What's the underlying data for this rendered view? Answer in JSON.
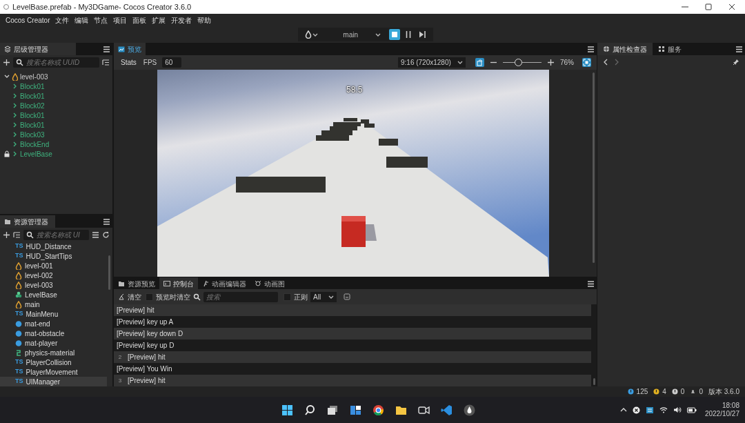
{
  "window": {
    "title": "LevelBase.prefab - My3DGame- Cocos Creator 3.6.0"
  },
  "menu": [
    "Cocos Creator",
    "文件",
    "编辑",
    "节点",
    "项目",
    "面板",
    "扩展",
    "开发者",
    "帮助"
  ],
  "toolbar": {
    "scene_select": "main",
    "play_controls": [
      {
        "kind": "stop",
        "active": true
      },
      {
        "kind": "pause",
        "active": false
      },
      {
        "kind": "step",
        "active": false
      }
    ]
  },
  "hierarchy": {
    "title": "层级管理器",
    "search": {
      "placeholder": "搜索名称或 UUID"
    },
    "tree": [
      {
        "label": "level-003",
        "kind": "scene",
        "expanded": true,
        "locked": false,
        "children": [
          {
            "label": "Block01",
            "kind": "prefab",
            "expanded": false,
            "locked": false
          },
          {
            "label": "Block01",
            "kind": "prefab",
            "expanded": false,
            "locked": false
          },
          {
            "label": "Block02",
            "kind": "prefab",
            "expanded": false,
            "locked": false
          },
          {
            "label": "Block01",
            "kind": "prefab",
            "expanded": false,
            "locked": false
          },
          {
            "label": "Block01",
            "kind": "prefab",
            "expanded": false,
            "locked": false
          },
          {
            "label": "Block03",
            "kind": "prefab",
            "expanded": false,
            "locked": false
          },
          {
            "label": "BlockEnd",
            "kind": "prefab",
            "expanded": false,
            "locked": false
          }
        ]
      },
      {
        "label": "LevelBase",
        "kind": "prefab",
        "expanded": false,
        "locked": true
      }
    ]
  },
  "assets": {
    "title": "资源管理器",
    "search": {
      "placeholder": "搜索名称或 UI"
    },
    "items": [
      {
        "label": "HUD_Distance",
        "kind": "script",
        "tag": "TS",
        "selected": false
      },
      {
        "label": "HUD_StartTips",
        "kind": "script",
        "tag": "TS",
        "selected": false
      },
      {
        "label": "level-001",
        "kind": "scene",
        "selected": false
      },
      {
        "label": "level-002",
        "kind": "scene",
        "selected": false
      },
      {
        "label": "level-003",
        "kind": "scene",
        "selected": false
      },
      {
        "label": "LevelBase",
        "kind": "prefab",
        "selected": false
      },
      {
        "label": "main",
        "kind": "scene",
        "selected": false
      },
      {
        "label": "MainMenu",
        "kind": "script",
        "tag": "TS",
        "selected": false
      },
      {
        "label": "mat-end",
        "kind": "material",
        "selected": false
      },
      {
        "label": "mat-obstacle",
        "kind": "material",
        "selected": false
      },
      {
        "label": "mat-player",
        "kind": "material",
        "selected": false
      },
      {
        "label": "physics-material",
        "kind": "physics",
        "selected": false
      },
      {
        "label": "PlayerCollision",
        "kind": "script",
        "tag": "TS",
        "selected": false
      },
      {
        "label": "PlayerMovement",
        "kind": "script",
        "tag": "TS",
        "selected": false
      },
      {
        "label": "UIManager",
        "kind": "script",
        "tag": "TS",
        "selected": true
      }
    ]
  },
  "preview": {
    "tab": "预览",
    "stats": "Stats",
    "fps_label": "FPS",
    "fps": "60",
    "resolution": "9:16 (720x1280)",
    "zoom": {
      "level": 0.4,
      "reading": "76%"
    },
    "score": "58.5"
  },
  "console": {
    "tabs": [
      {
        "label": "资源预览",
        "kind": "folder",
        "selected": false
      },
      {
        "label": "控制台",
        "kind": "terminal",
        "selected": true
      },
      {
        "label": "动画编辑器",
        "kind": "animation",
        "selected": false
      },
      {
        "label": "动画图",
        "kind": "graph",
        "selected": false
      }
    ],
    "clear": "清空",
    "clear_on_preview": {
      "label": "预览时清空",
      "checked": false
    },
    "search": {
      "placeholder": "搜索"
    },
    "regex": {
      "label": "正则",
      "checked": false
    },
    "level_filter": "All",
    "logs": [
      {
        "text": "[Preview] hit"
      },
      {
        "text": "[Preview] key up A"
      },
      {
        "text": "[Preview] key down D"
      },
      {
        "text": "[Preview] key up D"
      },
      {
        "count": "2",
        "text": "[Preview] hit"
      },
      {
        "text": "[Preview] You Win"
      },
      {
        "count": "3",
        "text": "[Preview] hit"
      }
    ]
  },
  "inspector": {
    "tabs": [
      {
        "label": "属性检查器",
        "kind": "inspector",
        "selected": true
      },
      {
        "label": "服务",
        "kind": "services",
        "selected": false
      }
    ]
  },
  "status_bar": {
    "counts": [
      {
        "kind": "info",
        "value": "125"
      },
      {
        "kind": "warning",
        "value": "4"
      },
      {
        "kind": "error",
        "value": "0"
      },
      {
        "kind": "notice",
        "value": "0"
      }
    ],
    "version": "版本 3.6.0"
  },
  "taskbar": {
    "time": "18:08",
    "date": "2022/10/27"
  }
}
